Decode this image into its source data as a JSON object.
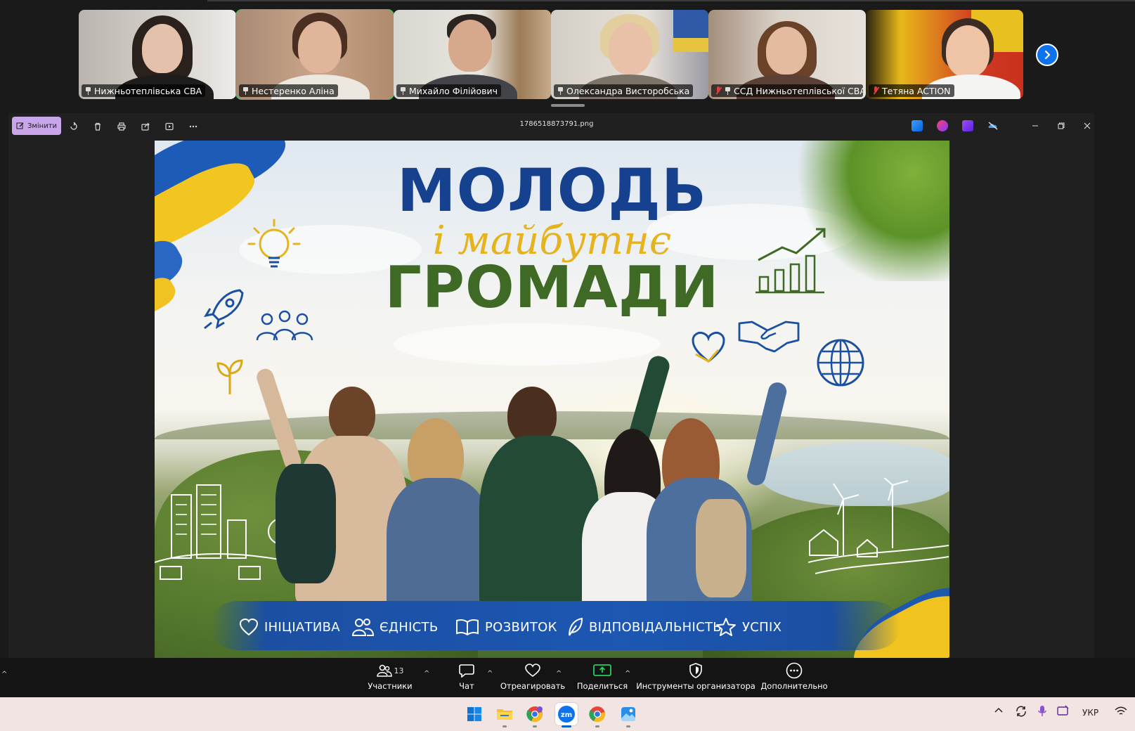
{
  "participants": [
    {
      "name": "Нижньотеплівська СВА",
      "pinned": true,
      "muted": false,
      "active": false
    },
    {
      "name": "Нестеренко Аліна",
      "pinned": true,
      "muted": false,
      "active": true
    },
    {
      "name": "Михайло Філійович",
      "pinned": true,
      "muted": false,
      "active": false
    },
    {
      "name": "Олександра Висторобська",
      "pinned": true,
      "muted": false,
      "active": false
    },
    {
      "name": "ССД Нижньотеплівської СВА...",
      "pinned": true,
      "muted": true,
      "active": false
    },
    {
      "name": "Тетяна ACTION",
      "pinned": false,
      "muted": true,
      "active": false
    }
  ],
  "viewer": {
    "edit_label": "Змінити",
    "file_name": "1786518873791.png"
  },
  "poster": {
    "title_line1": "МОЛОДЬ",
    "title_line2": "і майбутнє",
    "title_line3": "ГРОМАДИ",
    "values": [
      "ІНІЦІАТИВА",
      "ЄДНІСТЬ",
      "РОЗВИТОК",
      "ВІДПОВІДАЛЬНІСТЬ",
      "УСПІХ"
    ]
  },
  "toolbar": {
    "participants_label": "Участники",
    "participants_count": "13",
    "chat_label": "Чат",
    "react_label": "Отреагировать",
    "share_label": "Поделиться",
    "host_tools_label": "Инструменты организатора",
    "more_label": "Дополнительно"
  },
  "taskbar": {
    "language": "УКР"
  },
  "colors": {
    "zoom_blue": "#0e72ed",
    "active_speaker": "#23d160",
    "share_green": "#23d160",
    "title_blue": "#15418f",
    "title_yellow": "#e6b320",
    "title_green": "#3e6a25",
    "edit_button": "#c9a6e9"
  }
}
